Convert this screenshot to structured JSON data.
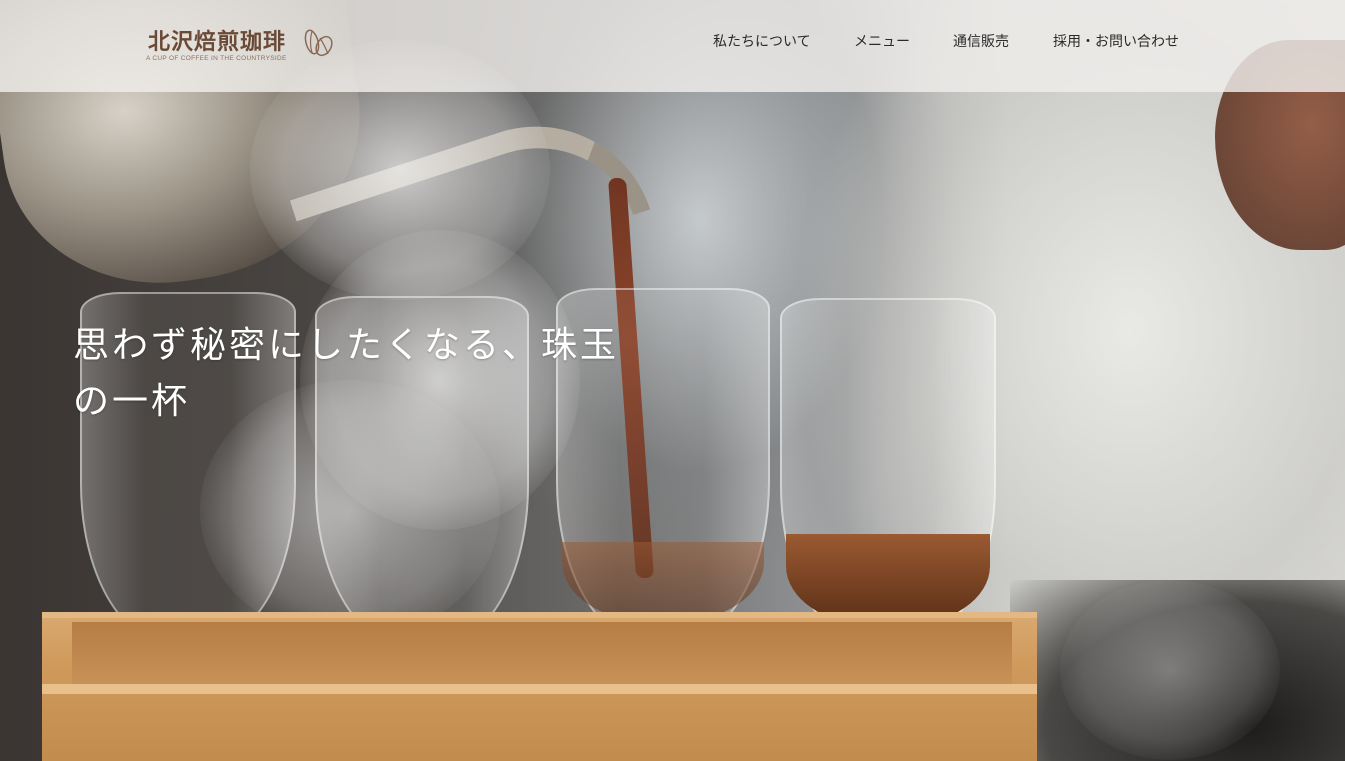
{
  "header": {
    "logo": {
      "name": "北沢焙煎珈琲",
      "tagline": "A CUP OF COFFEE IN THE COUNTRYSIDE",
      "icon": "coffee-bean-icon"
    },
    "nav": [
      {
        "label": "私たちについて"
      },
      {
        "label": "メニュー"
      },
      {
        "label": "通信販売"
      },
      {
        "label": "採用・お問い合わせ"
      }
    ]
  },
  "hero": {
    "title": "思わず秘密にしたくなる、珠玉の一杯"
  },
  "colors": {
    "header_bg": "#f0eeec",
    "logo_text": "#6a4a36",
    "nav_text": "#2a2a2a",
    "hero_text": "#ffffff"
  }
}
